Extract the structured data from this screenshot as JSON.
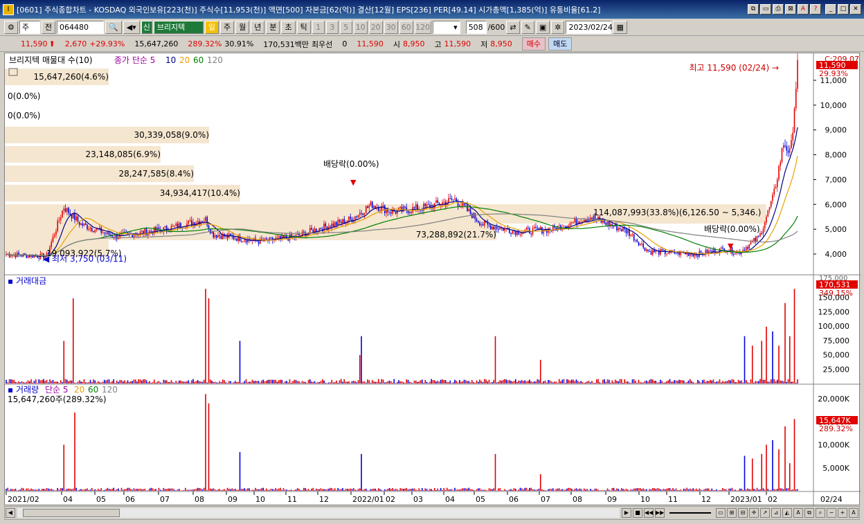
{
  "window": {
    "title": "[0601] 주식종합차트 - KOSDAQ 외국인보유[223(천)] 주식수[11,953(천)] 액면[500] 자본금[62(억)] 결산[12월] EPS[236] PER[49.14] 시가총액[1,385(억)] 유통비율[61.2]"
  },
  "toolbar": {
    "market": "주",
    "scope": "전",
    "code": "064480",
    "company_badge": "신",
    "company_name": "브리지텍",
    "period_day": "일",
    "period_week": "주",
    "period_month": "월",
    "period_year": "년",
    "period_min": "분",
    "period_sec": "초",
    "period_tick": "틱",
    "intervals": [
      "1",
      "3",
      "5",
      "10",
      "20",
      "30",
      "60",
      "120"
    ],
    "count": "508",
    "count_max": "/600",
    "date": "2023/02/24"
  },
  "quote": {
    "price": "11,590",
    "change": "2,670",
    "change_pct": "+29.93%",
    "volume": "15,647,260",
    "volume_pct": "289.32%",
    "turnover": "30.91%",
    "amount": "170,531백만",
    "pref_label": "최우선",
    "pref_value": "0",
    "pref_price": "11,590",
    "open_label": "시",
    "open": "8,950",
    "high_label": "고",
    "high": "11,590",
    "low_label": "저",
    "low": "8,950",
    "buy_label": "매수",
    "sell_label": "매도"
  },
  "price_panel": {
    "legend_name": "브리지텍 매물대 수(10)",
    "legend_ma": "종가 단순 5",
    "ma_periods": [
      "10",
      "20",
      "60",
      "120"
    ],
    "ma_colors": [
      "#000080",
      "#e8a000",
      "#008000",
      "#808080"
    ],
    "c_label": "C:209.07",
    "current_price": "11,590",
    "current_pct": "29.93%",
    "high_note": "최고 11,590 (02/24)",
    "low_note": "최저 3,750 (03/11)",
    "dividend1": "배당락(0.00%)",
    "dividend2": "배당락(0.00%)",
    "yticks": [
      "11,000",
      "10,000",
      "9,000",
      "8,000",
      "7,000",
      "6,000",
      "5,000",
      "4,000"
    ],
    "profile": [
      {
        "label": "15,647,260(4.6%)"
      },
      {
        "label": "0(0.0%)"
      },
      {
        "label": "0(0.0%)"
      },
      {
        "label": "30,339,058(9.0%)"
      },
      {
        "label": "23,148,085(6.9%)"
      },
      {
        "label": "28,247,585(8.4%)"
      },
      {
        "label": "34,934,417(10.4%)"
      },
      {
        "label": "114,087,993(33.8%)(6,126.50 ~ 5,346.)"
      },
      {
        "label": "73,288,892(21.7%)"
      },
      {
        "label": "19,093,922(5.7%)"
      }
    ]
  },
  "amount_panel": {
    "legend": "거래대금",
    "current": "170,531",
    "pct": "349.15%",
    "top": "175,000",
    "yticks": [
      "150,000",
      "125,000",
      "100,000",
      "75,000",
      "50,000",
      "25,000"
    ]
  },
  "volume_panel": {
    "legend": "거래량",
    "legend_ma": "단순 5",
    "ma_periods": [
      "20",
      "60",
      "120"
    ],
    "ma_colors": [
      "#e8a000",
      "#008000",
      "#808080"
    ],
    "sub": "15,647,260주(289.32%)",
    "current": "15,647K",
    "pct": "289.32%",
    "yticks": [
      "20,000K",
      "15,000K",
      "10,000K",
      "5,000K"
    ]
  },
  "xaxis": {
    "labels": [
      "2021/02",
      "04",
      "05",
      "06",
      "07",
      "08",
      "09",
      "10",
      "11",
      "12",
      "2022/01",
      "02",
      "03",
      "04",
      "05",
      "06",
      "07",
      "08",
      "09",
      "10",
      "11",
      "12",
      "2023/01",
      "02"
    ],
    "right_label": "02/24"
  },
  "colors": {
    "up": "#e00000",
    "down": "#0000e0",
    "profile": "#f5e6d0"
  }
}
